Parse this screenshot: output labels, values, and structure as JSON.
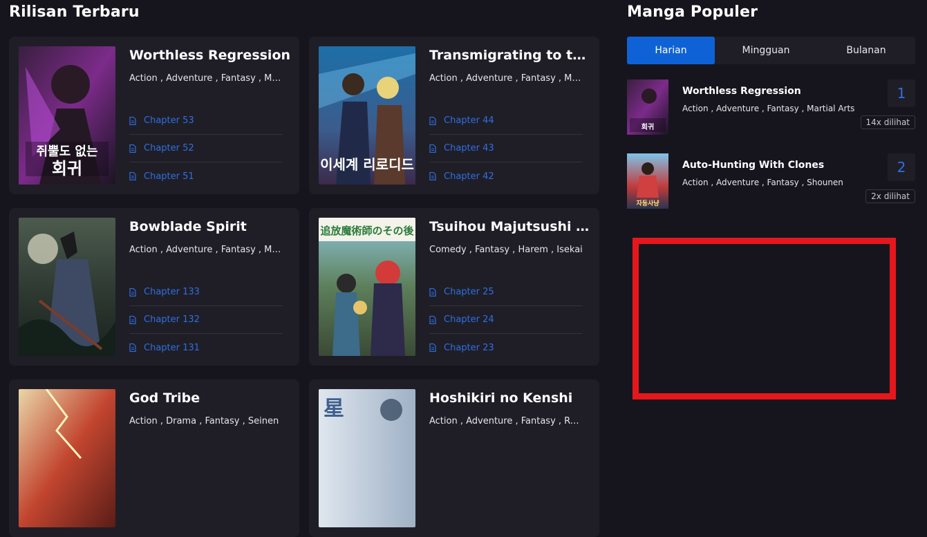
{
  "latest": {
    "title": "Rilisan Terbaru",
    "cards": [
      {
        "title": "Worthless Regression",
        "genres": "Action , Adventure , Fantasy , Martial Arts",
        "chapters": [
          "Chapter 53",
          "Chapter 52",
          "Chapter 51"
        ],
        "cover_text": "쥐뿔도 없는 회귀"
      },
      {
        "title": "Transmigrating to the Otherworld Once More",
        "genres": "Action , Adventure , Fantasy , Magic",
        "chapters": [
          "Chapter 44",
          "Chapter 43",
          "Chapter 42"
        ],
        "cover_text": "이세계 리로디드"
      },
      {
        "title": "Bowblade Spirit",
        "genres": "Action , Adventure , Fantasy , Martial Arts",
        "chapters": [
          "Chapter 133",
          "Chapter 132",
          "Chapter 131"
        ],
        "cover_text": ""
      },
      {
        "title": "Tsuihou Majutsushi no Sono Go",
        "genres": "Comedy , Fantasy , Harem , Isekai",
        "chapters": [
          "Chapter 25",
          "Chapter 24",
          "Chapter 23"
        ],
        "cover_text": "追放魔術師のその後"
      },
      {
        "title": "God Tribe",
        "genres": "Action , Drama , Fantasy , Seinen",
        "chapters": [],
        "cover_text": ""
      },
      {
        "title": "Hoshikiri no Kenshi",
        "genres": "Action , Adventure , Fantasy , Romance",
        "chapters": [],
        "cover_text": "星"
      }
    ]
  },
  "popular": {
    "title": "Manga Populer",
    "tabs": [
      "Harian",
      "Mingguan",
      "Bulanan"
    ],
    "active_tab": "Harian",
    "items": [
      {
        "rank": "1",
        "title": "Worthless Regression",
        "genres": "Action , Adventure , Fantasy , Martial Arts",
        "views": "14x dilihat"
      },
      {
        "rank": "2",
        "title": "Auto-Hunting With Clones",
        "genres": "Action , Adventure , Fantasy , Shounen",
        "views": "2x dilihat"
      }
    ]
  },
  "colors": {
    "accent": "#0f62d6",
    "link": "#2f6fe0",
    "background": "#16151d",
    "card": "#1f1e27",
    "ad_border": "#e6171c"
  },
  "icons": {
    "chapter": "document-icon"
  }
}
